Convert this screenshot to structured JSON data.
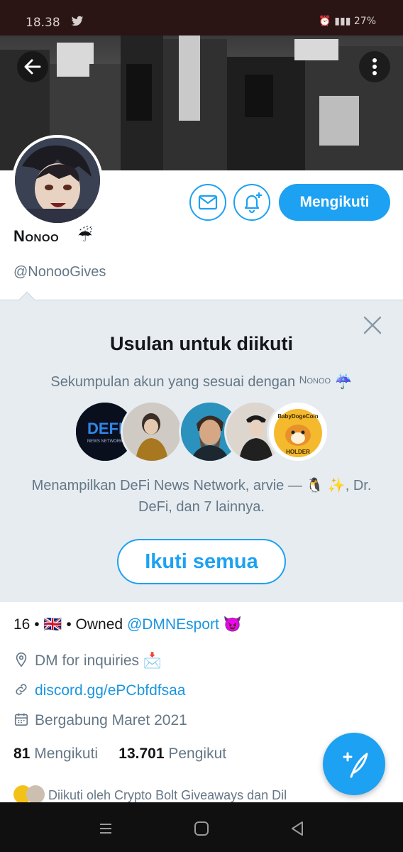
{
  "status_bar": {
    "time": "18.38",
    "battery": "27%"
  },
  "header": {
    "back_icon": "arrow-left-icon",
    "menu_icon": "more-vertical-icon"
  },
  "profile": {
    "display_name": "Nonoo",
    "display_emoji": "☔",
    "handle": "@NonooGives",
    "follow_label": "Mengikuti"
  },
  "suggestions": {
    "title": "Usulan untuk diikuti",
    "subtitle_prefix": "Sekumpulan akun yang sesuai dengan",
    "subtitle_name": "Nonoo",
    "subtitle_emoji": "☔",
    "avatars": [
      {
        "name": "DeFi News Network",
        "logo_text": "DEFI",
        "logo_sub": "NEWS NETWORK"
      },
      {
        "name": "arvie"
      },
      {
        "name": "Dr. DeFi"
      },
      {
        "name": "account-4"
      },
      {
        "name": "BabyDogeCoin",
        "logo_text": "BabyDogeCoin",
        "logo_sub": "HOLDER"
      }
    ],
    "description": "Menampilkan DeFi News Network, arvie — 🐧 ✨, Dr. DeFi, dan 7 lainnya.",
    "follow_all_label": "Ikuti semua"
  },
  "bio": {
    "prefix": "16 • 🇬🇧 • Owned",
    "mention": "@DMNEsport",
    "emoji": "😈"
  },
  "meta": {
    "location": "DM for inquiries 📩",
    "url": "discord.gg/ePCbfdfsaa",
    "joined": "Bergabung Maret 2021"
  },
  "counts": {
    "following_num": "81",
    "following_label": "Mengikuti",
    "followers_num": "13.701",
    "followers_label": "Pengikut"
  },
  "followed_by": "Diikuti oleh Crypto Bolt Giveaways dan Dil",
  "colors": {
    "accent": "#1da1f2",
    "panel_bg": "#e6ecf0",
    "muted_text": "#657786"
  }
}
